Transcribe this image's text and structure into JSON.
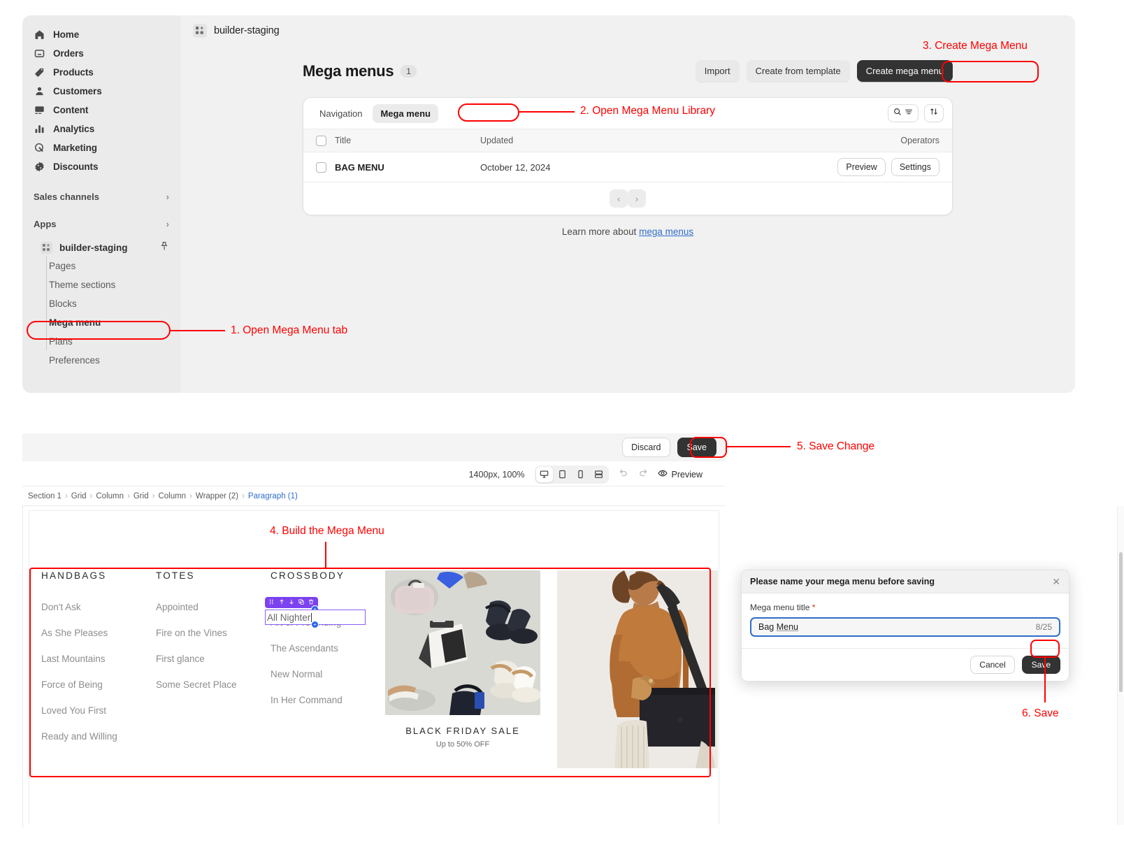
{
  "sidebar": {
    "items": [
      {
        "label": "Home",
        "icon": "home-icon"
      },
      {
        "label": "Orders",
        "icon": "orders-icon"
      },
      {
        "label": "Products",
        "icon": "products-tag-icon"
      },
      {
        "label": "Customers",
        "icon": "customers-person-icon"
      },
      {
        "label": "Content",
        "icon": "content-image-icon"
      },
      {
        "label": "Analytics",
        "icon": "analytics-bars-icon"
      },
      {
        "label": "Marketing",
        "icon": "marketing-target-icon"
      },
      {
        "label": "Discounts",
        "icon": "discounts-badge-icon"
      }
    ],
    "groups": [
      {
        "label": "Sales channels",
        "chevron": "›"
      },
      {
        "label": "Apps",
        "chevron": "›"
      }
    ],
    "app": {
      "label": "builder-staging",
      "icon": "app-grid-icon",
      "pin_icon": "pin-icon"
    },
    "sub_items": [
      {
        "label": "Pages",
        "active": false
      },
      {
        "label": "Theme sections",
        "active": false
      },
      {
        "label": "Blocks",
        "active": false
      },
      {
        "label": "Mega menu",
        "active": true
      },
      {
        "label": "Plans",
        "active": false
      },
      {
        "label": "Preferences",
        "active": false
      }
    ]
  },
  "breadcrumb": {
    "icon": "app-grid-icon",
    "label": "builder-staging"
  },
  "page": {
    "title": "Mega menus",
    "count": "1",
    "actions": [
      {
        "label": "Import",
        "style": "plain"
      },
      {
        "label": "Create from template",
        "style": "plain"
      },
      {
        "label": "Create mega menu",
        "style": "dark"
      }
    ],
    "learn_prefix": "Learn more about ",
    "learn_link": "mega menus"
  },
  "card": {
    "tabs": [
      {
        "label": "Navigation",
        "active": false
      },
      {
        "label": "Mega menu",
        "active": true
      }
    ],
    "tools": [
      {
        "name": "search-filter-button",
        "icons": [
          "search-icon",
          "filter-icon"
        ]
      },
      {
        "name": "sort-button",
        "icons": [
          "sort-arrows-icon"
        ]
      }
    ],
    "columns": [
      "Title",
      "Updated",
      "Operators"
    ],
    "rows": [
      {
        "title": "BAG MENU",
        "updated": "October 12, 2024",
        "ops": [
          "Preview",
          "Settings"
        ]
      }
    ],
    "pager": {
      "prev": "‹",
      "next": "›"
    }
  },
  "builder": {
    "discard_label": "Discard",
    "save_label": "Save",
    "zoom": "1400px, 100%",
    "devices": [
      {
        "name": "desktop-icon",
        "active": true
      },
      {
        "name": "tablet-icon",
        "active": false
      },
      {
        "name": "mobile-icon",
        "active": false
      },
      {
        "name": "fullwidth-icon",
        "active": false
      }
    ],
    "undo_icon": "undo-icon",
    "redo_icon": "redo-icon",
    "preview_label": "Preview",
    "preview_icon": "eye-icon",
    "path": [
      "Section 1",
      "Grid",
      "Column",
      "Grid",
      "Column",
      "Wrapper (2)",
      "Paragraph (1)"
    ],
    "path_separator": "›"
  },
  "mega_menu": {
    "columns": [
      {
        "heading": "HANDBAGS",
        "links": [
          "Don't Ask",
          "As She Pleases",
          "Last Mountains",
          "Force of Being",
          "Loved You First",
          "Ready and Willing"
        ]
      },
      {
        "heading": "TOTES",
        "links": [
          "Appointed",
          "Fire on the Vines",
          "First glance",
          "Some Secret Place"
        ]
      },
      {
        "heading": "CROSSBODY",
        "links": [
          "All Nighter",
          "Art of Pretending",
          "The Ascendants",
          "New Normal",
          "In Her Command"
        ]
      }
    ],
    "editing": {
      "value": "All Nighter",
      "toolbar_icons": [
        "drag-handle-icon",
        "move-up-icon",
        "move-down-icon",
        "duplicate-icon",
        "delete-icon"
      ],
      "add_handle_icon": "plus-icon"
    },
    "promo": {
      "title": "BLACK FRIDAY SALE",
      "subtitle": "Up to 50% OFF"
    }
  },
  "modal": {
    "title": "Please name your mega menu before saving",
    "close_icon": "close-icon",
    "field_label": "Mega menu title",
    "required_marker": "*",
    "value": "Bag Menu",
    "value_plain": "Bag ",
    "value_underlined": "Menu",
    "counter": "8/25",
    "cancel_label": "Cancel",
    "save_label": "Save"
  },
  "annotations": [
    {
      "id": "step1",
      "text": "1. Open Mega Menu tab"
    },
    {
      "id": "step2",
      "text": "2. Open Mega Menu Library"
    },
    {
      "id": "step3",
      "text": "3. Create Mega Menu"
    },
    {
      "id": "step4",
      "text": "4. Build the Mega Menu"
    },
    {
      "id": "step5",
      "text": "5. Save Change"
    },
    {
      "id": "step6",
      "text": "6. Save"
    }
  ],
  "colors": {
    "annotation": "#ff0000",
    "link": "#2f6ecb",
    "dark_button": "#333333",
    "editor_purple": "#7b42f0",
    "handle_blue": "#2563eb"
  }
}
